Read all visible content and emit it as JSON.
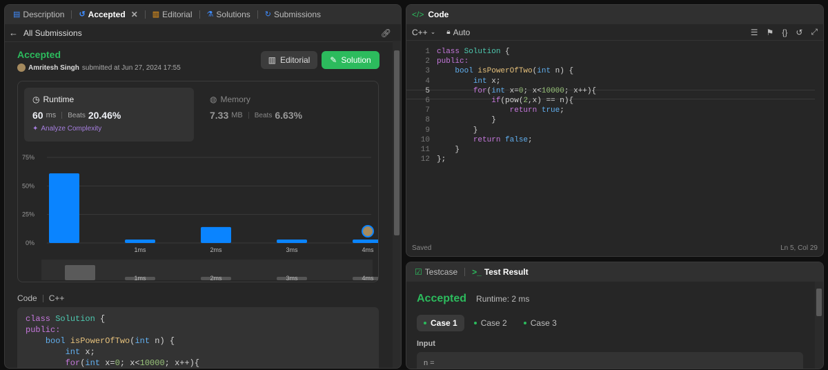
{
  "left_tabs": {
    "description": "Description",
    "accepted": "Accepted",
    "editorial": "Editorial",
    "solutions": "Solutions",
    "submissions": "Submissions"
  },
  "all_submissions": "All Submissions",
  "status": {
    "label": "Accepted",
    "user": "Amritesh Singh",
    "submitted_at": "submitted at Jun 27, 2024 17:55"
  },
  "buttons": {
    "editorial": "Editorial",
    "solution": "Solution"
  },
  "runtime": {
    "title": "Runtime",
    "value": "60",
    "unit": "ms",
    "beats_label": "Beats",
    "beats": "20.46%",
    "analyze": "Analyze Complexity"
  },
  "memory": {
    "title": "Memory",
    "value": "7.33",
    "unit": "MB",
    "beats_label": "Beats",
    "beats": "6.63%"
  },
  "chart_data": {
    "type": "bar",
    "categories": [
      "",
      "1ms",
      "2ms",
      "3ms",
      "4ms"
    ],
    "values": [
      61,
      3,
      14,
      3,
      3
    ],
    "ylim": [
      0,
      75
    ],
    "yticks": [
      "0%",
      "25%",
      "50%",
      "75%"
    ],
    "highlighted_category": "4ms",
    "colors": {
      "bar": "#0a84ff",
      "grid": "#3a3a3a"
    }
  },
  "mini_labels": [
    "1ms",
    "2ms",
    "3ms",
    "4ms"
  ],
  "code_section": {
    "label": "Code",
    "lang": "C++"
  },
  "code_lines": [
    [
      [
        "class ",
        "kw"
      ],
      [
        "Solution",
        "cl"
      ],
      [
        " {",
        "tx"
      ]
    ],
    [
      [
        "public:",
        "kw"
      ]
    ],
    [
      [
        "    ",
        "tx"
      ],
      [
        "bool ",
        "ty"
      ],
      [
        "isPowerOfTwo",
        "fn"
      ],
      [
        "(",
        "tx"
      ],
      [
        "int",
        "ty"
      ],
      [
        " n) {",
        "tx"
      ]
    ],
    [
      [
        "        ",
        "tx"
      ],
      [
        "int",
        "ty"
      ],
      [
        " x;",
        "tx"
      ]
    ],
    [
      [
        "        ",
        "tx"
      ],
      [
        "for",
        "kw"
      ],
      [
        "(",
        "tx"
      ],
      [
        "int",
        "ty"
      ],
      [
        " x=",
        "tx"
      ],
      [
        "0",
        "nm"
      ],
      [
        "; x<",
        "tx"
      ],
      [
        "10000",
        "nm"
      ],
      [
        "; x++){",
        "tx"
      ]
    ],
    [
      [
        "            ",
        "tx"
      ],
      [
        "if",
        "kw"
      ],
      [
        "(pow(",
        "tx"
      ],
      [
        "2",
        "nm"
      ],
      [
        ",x) == n){",
        "tx"
      ]
    ],
    [
      [
        "                ",
        "tx"
      ],
      [
        "return ",
        "kw"
      ],
      [
        "true",
        "ty"
      ],
      [
        ";",
        "tx"
      ]
    ],
    [
      [
        "            }",
        "tx"
      ]
    ],
    [
      [
        "        }",
        "tx"
      ]
    ],
    [
      [
        "        ",
        "tx"
      ],
      [
        "return ",
        "kw"
      ],
      [
        "false",
        "ty"
      ],
      [
        ";",
        "tx"
      ]
    ],
    [
      [
        "    }",
        "tx"
      ]
    ],
    [
      [
        "};",
        "tx"
      ]
    ]
  ],
  "editor": {
    "title": "Code",
    "lang": "C++",
    "mode": "Auto",
    "saved": "Saved",
    "position": "Ln 5, Col 29"
  },
  "result": {
    "tab_testcase": "Testcase",
    "tab_result": "Test Result",
    "status": "Accepted",
    "runtime": "Runtime: 2 ms",
    "cases": [
      "Case 1",
      "Case 2",
      "Case 3"
    ],
    "input_label": "Input",
    "input_var": "n ="
  }
}
